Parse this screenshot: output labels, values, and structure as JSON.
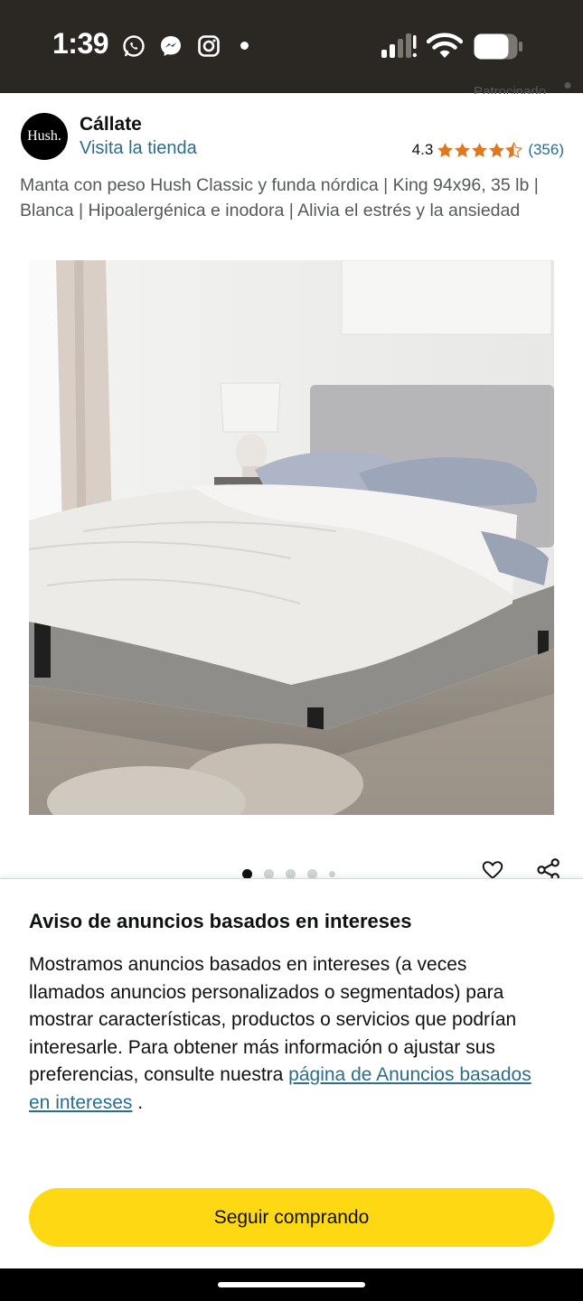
{
  "status_bar": {
    "time": "1:39",
    "icons": [
      "whatsapp-icon",
      "messenger-icon",
      "instagram-icon",
      "dot",
      "signal-icon",
      "wifi-icon",
      "battery-icon"
    ]
  },
  "header": {
    "sponsored_label": "Patrocinado"
  },
  "product": {
    "brand_logo_text": "Hush.",
    "brand_name": "Cállate",
    "store_link": "Visita la tienda",
    "rating": "4.3",
    "rating_stars": 4.3,
    "review_count": "(356)",
    "title": "Manta con peso Hush Classic y funda nórdica | King 94x96, 35 lb | Blanca | Hipoalergénica e inodora | Alivia el estrés y la ansiedad",
    "carousel_total_dots": 5,
    "carousel_active_index": 0
  },
  "notice": {
    "title": "Aviso de anuncios basados en intereses",
    "body_text": "Mostramos anuncios basados en intereses (a veces llamados anuncios personalizados o segmentados) para mostrar características, productos o servicios que podrían interesarle. Para obtener más información o ajustar sus preferencias, consulte nuestra ",
    "link_text": "página de Anuncios basados en intereses",
    "body_end": " .",
    "button_label": "Seguir comprando"
  },
  "colors": {
    "status_bar_bg": "#2b2723",
    "link": "#2a6e8c",
    "star": "#de7921",
    "button": "#ffd814",
    "text": "#0f1111",
    "secondary_text": "#565959"
  }
}
